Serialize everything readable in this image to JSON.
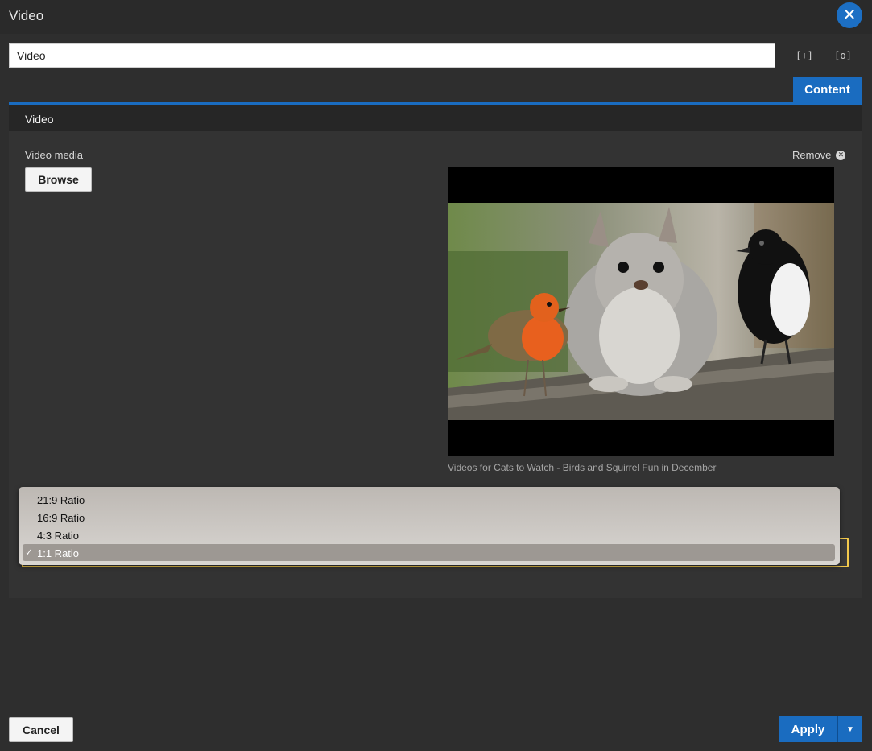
{
  "modal": {
    "title": "Video",
    "close_icon": "close-icon"
  },
  "name_field": {
    "value": "Video"
  },
  "toolbar": {
    "expand_icon": "[+]",
    "preview_icon": "[o]"
  },
  "tabs": [
    {
      "label": "Content",
      "active": true
    }
  ],
  "section": {
    "title": "Video",
    "media_label": "Video media",
    "browse_label": "Browse",
    "remove_label": "Remove",
    "video_caption": "Videos for Cats to Watch - Birds and Squirrel Fun in December"
  },
  "ratio_dropdown": {
    "options": [
      "21:9 Ratio",
      "16:9 Ratio",
      "4:3 Ratio",
      "1:1 Ratio"
    ],
    "selected": "1:1 Ratio",
    "check": "✓"
  },
  "footer": {
    "cancel_label": "Cancel",
    "apply_label": "Apply"
  },
  "colors": {
    "accent": "#1a6cc0",
    "focus": "#f2c94c"
  }
}
